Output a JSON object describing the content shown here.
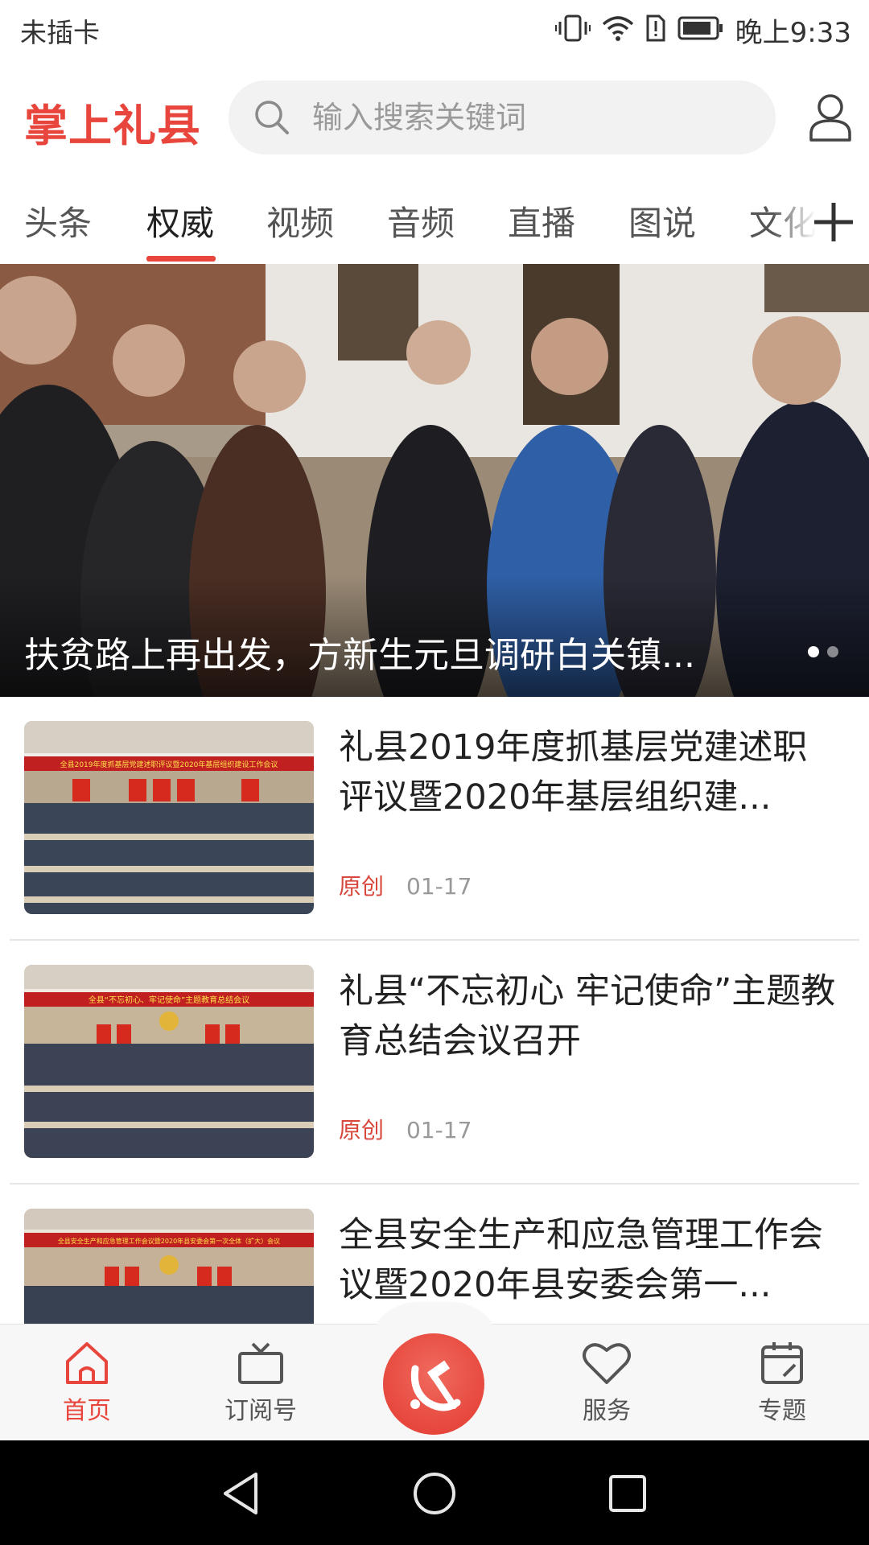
{
  "status_bar": {
    "carrier": "未插卡",
    "time": "晚上9:33"
  },
  "header": {
    "app_title": "掌上礼县",
    "search_placeholder": "输入搜索关键词"
  },
  "tabs": [
    {
      "label": "头条",
      "active": false
    },
    {
      "label": "权威",
      "active": true
    },
    {
      "label": "视频",
      "active": false
    },
    {
      "label": "音频",
      "active": false
    },
    {
      "label": "直播",
      "active": false
    },
    {
      "label": "图说",
      "active": false
    },
    {
      "label": "文化",
      "active": false
    }
  ],
  "hero": {
    "title": "扶贫路上再出发，方新生元旦调研白关镇...",
    "slide_count": 2,
    "active_slide": 1
  },
  "news": [
    {
      "title": "礼县2019年度抓基层党建述职评议暨2020年基层组织建...",
      "source": "原创",
      "date": "01-17",
      "banner_text": "全县2019年度抓基层党建述职评议暨2020年基层组织建设工作会议"
    },
    {
      "title": "礼县“不忘初心 牢记使命”主题教育总结会议召开",
      "source": "原创",
      "date": "01-17",
      "banner_text": "全县“不忘初心、牢记使命”主题教育总结会议"
    },
    {
      "title": "全县安全生产和应急管理工作会议暨2020年县安委会第一...",
      "banner_text": "全县安全生产和应急管理工作会议暨2020年县安委会第一次全体（扩大）会议"
    }
  ],
  "bottom_nav": {
    "home": "首页",
    "subscribe": "订阅号",
    "service": "服务",
    "topics": "专题"
  },
  "colors": {
    "accent": "#e8453c",
    "text": "#222222",
    "muted": "#999999",
    "nav_bg": "#f7f7f7"
  }
}
